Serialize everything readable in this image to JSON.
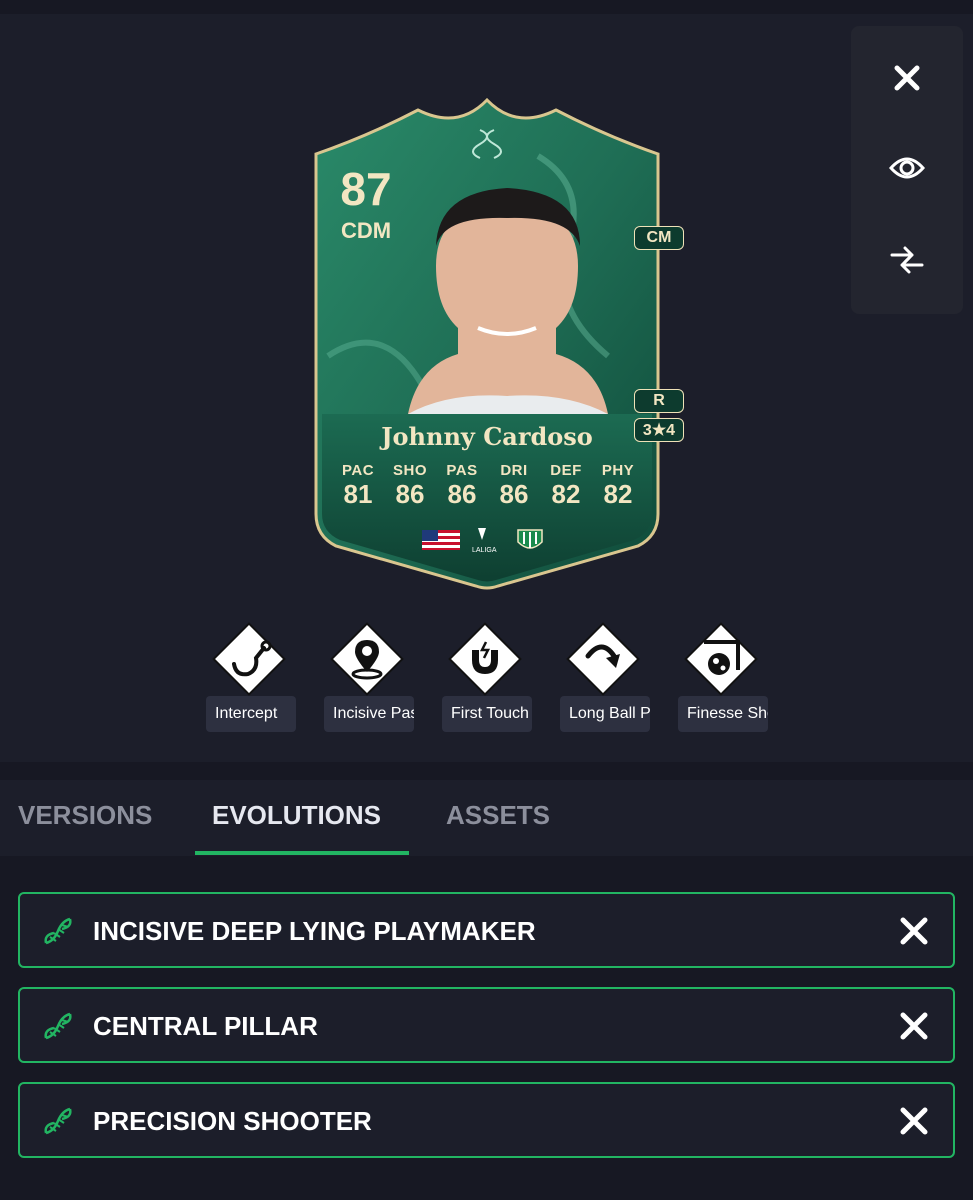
{
  "player": {
    "rating": "87",
    "position": "CDM",
    "alt_position": "CM",
    "foot": "R",
    "skill_weak": "3★4",
    "name": "Johnny Cardoso",
    "league_logo_text": "LALIGA",
    "stats": [
      {
        "label": "PAC",
        "value": "81"
      },
      {
        "label": "SHO",
        "value": "86"
      },
      {
        "label": "PAS",
        "value": "86"
      },
      {
        "label": "DRI",
        "value": "86"
      },
      {
        "label": "DEF",
        "value": "82"
      },
      {
        "label": "PHY",
        "value": "82"
      }
    ],
    "colors": {
      "card_green": "#1f6e55",
      "card_gold": "#f2e6c2"
    }
  },
  "toolbar": {
    "close_icon": "close-icon",
    "view_icon": "eye-icon",
    "compare_icon": "compare-arrows-icon"
  },
  "playstyles": [
    {
      "label": "Intercept",
      "icon": "intercept-icon"
    },
    {
      "label": "Incisive Pass",
      "icon": "incisive-pass-icon"
    },
    {
      "label": "First Touch",
      "icon": "first-touch-icon"
    },
    {
      "label": "Long Ball Pass",
      "icon": "long-ball-pass-icon"
    },
    {
      "label": "Finesse Shot",
      "icon": "finesse-shot-icon"
    }
  ],
  "tabs": [
    {
      "label": "VERSIONS",
      "active": false
    },
    {
      "label": "EVOLUTIONS",
      "active": true
    },
    {
      "label": "ASSETS",
      "active": false
    }
  ],
  "evolutions": [
    {
      "title": "INCISIVE DEEP LYING PLAYMAKER"
    },
    {
      "title": "CENTRAL PILLAR"
    },
    {
      "title": "PRECISION SHOOTER"
    }
  ],
  "accent_color": "#22b562"
}
